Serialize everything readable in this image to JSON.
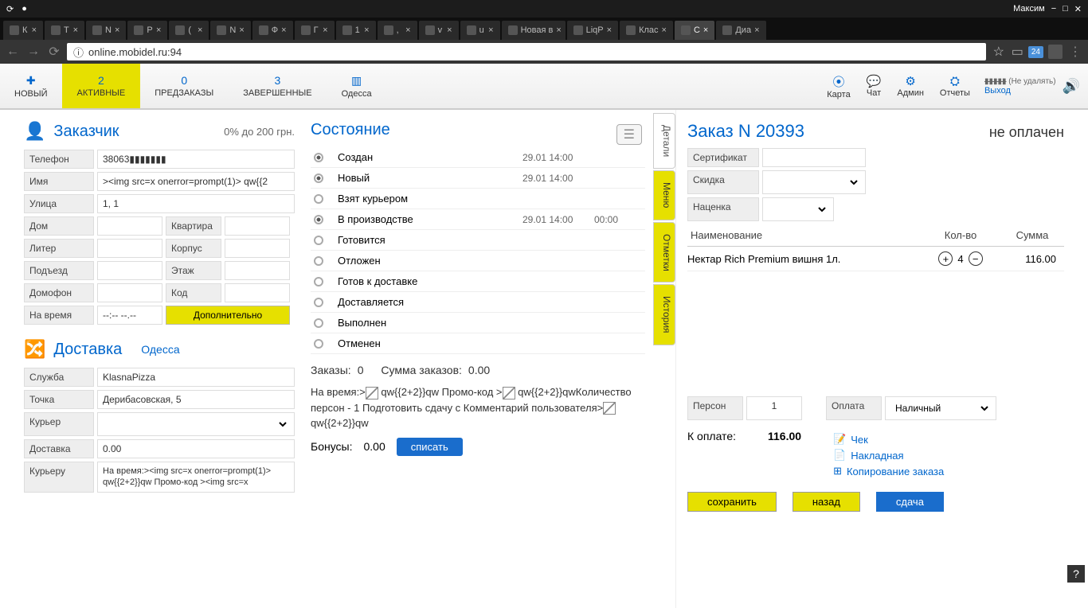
{
  "os": {
    "user": "Максим",
    "window_controls": [
      "−",
      "□",
      "✕"
    ]
  },
  "browser": {
    "tabs": [
      {
        "label": "К"
      },
      {
        "label": "Т"
      },
      {
        "label": "N"
      },
      {
        "label": "Р"
      },
      {
        "label": "("
      },
      {
        "label": "N"
      },
      {
        "label": "Ф"
      },
      {
        "label": "Г"
      },
      {
        "label": "1"
      },
      {
        "label": ","
      },
      {
        "label": "v"
      },
      {
        "label": "u"
      },
      {
        "label": "Новая в"
      },
      {
        "label": "LiqP"
      },
      {
        "label": "Клас"
      },
      {
        "label": "С",
        "active": true
      },
      {
        "label": "Диа"
      }
    ],
    "url": "online.mobidel.ru:94",
    "ext_badge": "24"
  },
  "toolbar": {
    "new": {
      "icon": "✚",
      "label": "НОВЫЙ"
    },
    "active": {
      "count": "2",
      "label": "АКТИВНЫЕ"
    },
    "preorders": {
      "count": "0",
      "label": "ПРЕДЗАКАЗЫ"
    },
    "done": {
      "count": "3",
      "label": "ЗАВЕРШЕННЫЕ"
    },
    "city": {
      "icon": "▥",
      "label": "Одесса"
    },
    "right": {
      "map": {
        "icon": "⦿",
        "label": "Карта"
      },
      "chat": {
        "icon": "💬",
        "label": "Чат"
      },
      "admin": {
        "icon": "⚙",
        "label": "Админ"
      },
      "reports": {
        "icon": "⛭",
        "label": "Отчеты"
      },
      "user_note": "(Не удалять)",
      "logout": "Выход",
      "sound": "🔊"
    }
  },
  "customer": {
    "title": "Заказчик",
    "extra": "0% до 200 грн.",
    "fields": {
      "phone_l": "Телефон",
      "phone_v": "38063▮▮▮▮▮▮▮",
      "name_l": "Имя",
      "name_v": "><img src=x onerror=prompt(1)> qw{{2",
      "street_l": "Улица",
      "street_v": "1, 1",
      "house_l": "Дом",
      "house_v": "",
      "flat_l": "Квартира",
      "flat_v": "",
      "liter_l": "Литер",
      "liter_v": "",
      "korpus_l": "Корпус",
      "korpus_v": "",
      "entrance_l": "Подъезд",
      "entrance_v": "",
      "floor_l": "Этаж",
      "floor_v": "",
      "intercom_l": "Домофон",
      "intercom_v": "",
      "code_l": "Код",
      "code_v": "",
      "time_l": "На время",
      "time_v": "--:-- --.--",
      "extra_btn": "Дополнительно"
    }
  },
  "delivery": {
    "title": "Доставка",
    "city_link": "Одесса",
    "fields": {
      "service_l": "Служба",
      "service_v": "KlasnaPizza",
      "point_l": "Точка",
      "point_v": "Дерибасовская, 5",
      "courier_l": "Курьер",
      "courier_v": "",
      "delivery_l": "Доставка",
      "delivery_v": "0.00",
      "courier_note_l": "Курьеру",
      "courier_note_v": "На время:><img src=x onerror=prompt(1)> qw{{2+2}}qw Промо-код ><img src=x"
    }
  },
  "status": {
    "title": "Состояние",
    "rows": [
      {
        "label": "Создан",
        "time": "29.01 14:00",
        "dur": "",
        "on": true
      },
      {
        "label": "Новый",
        "time": "29.01 14:00",
        "dur": "",
        "on": true
      },
      {
        "label": "Взят курьером",
        "time": "",
        "dur": "",
        "on": false
      },
      {
        "label": "В производстве",
        "time": "29.01 14:00",
        "dur": "00:00",
        "on": true
      },
      {
        "label": "Готовится",
        "time": "",
        "dur": "",
        "on": false
      },
      {
        "label": "Отложен",
        "time": "",
        "dur": "",
        "on": false
      },
      {
        "label": "Готов к доставке",
        "time": "",
        "dur": "",
        "on": false
      },
      {
        "label": "Доставляется",
        "time": "",
        "dur": "",
        "on": false
      },
      {
        "label": "Выполнен",
        "time": "",
        "dur": "",
        "on": false
      },
      {
        "label": "Отменен",
        "time": "",
        "dur": "",
        "on": false
      }
    ],
    "list_btn": "☰"
  },
  "summary": {
    "orders_l": "Заказы:",
    "orders_v": "0",
    "sum_l": "Сумма заказов:",
    "sum_v": "0.00",
    "note": "На время:> qw{{2+2}}qw Промо-код > qw{{2+2}}qwКоличество персон - 1 Подготовить сдачу с Комментарий пользователя> qw{{2+2}}qw",
    "bonus_l": "Бонусы:",
    "bonus_v": "0.00",
    "bonus_btn": "списать"
  },
  "side_tabs": [
    "Детали",
    "Меню",
    "Отметки",
    "История"
  ],
  "order": {
    "title": "Заказ N 20393",
    "pay_status": "не оплачен",
    "cert_l": "Сертификат",
    "discount_l": "Скидка",
    "markup_l": "Наценка",
    "cols": {
      "name": "Наименование",
      "qty": "Кол-во",
      "sum": "Сумма"
    },
    "items": [
      {
        "name": "Нектар Rich Premium вишня 1л.",
        "qty": "4",
        "sum": "116.00"
      }
    ],
    "persons_l": "Персон",
    "persons_v": "1",
    "payment_l": "Оплата",
    "payment_v": "Наличный",
    "actions": {
      "check": "Чек",
      "invoice": "Накладная",
      "copy": "Копирование заказа"
    },
    "total_l": "К оплате:",
    "total_v": "116.00",
    "buttons": {
      "save": "сохранить",
      "back": "назад",
      "change": "сдача"
    }
  },
  "help": "?"
}
